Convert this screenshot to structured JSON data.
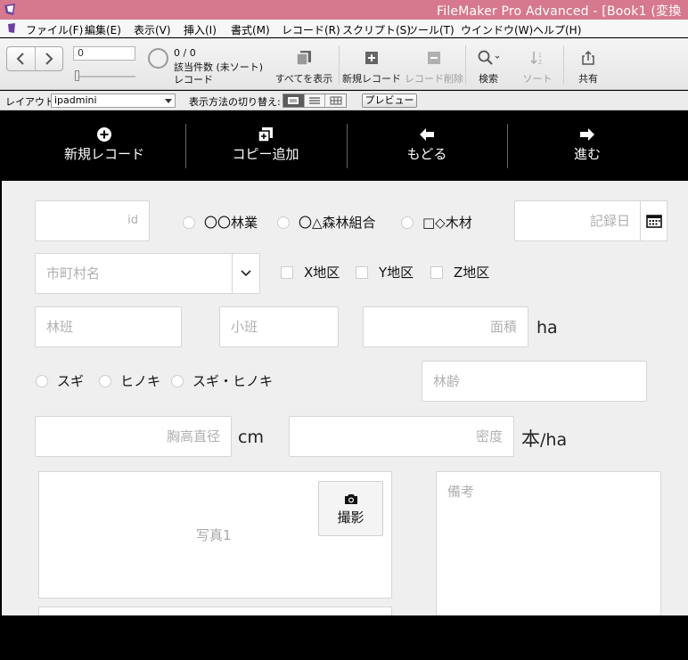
{
  "window": {
    "title": "FileMaker Pro Advanced - [Book1 (変換"
  },
  "menu": {
    "items": [
      "ファイル(F)",
      "編集(E)",
      "表示(V)",
      "挿入(I)",
      "書式(M)",
      "レコード(R)",
      "スクリプト(S)",
      "ツール(T)",
      "ウインドウ(W)",
      "ヘルプ(H)"
    ]
  },
  "toolbar": {
    "record_field_value": "0",
    "count": "0 / 0",
    "found_label": "該当件数 (未ソート)",
    "records_label": "レコード",
    "show_all_label": "すべてを表示",
    "new_record_label": "新規レコード",
    "delete_record_label": "レコード削除",
    "find_label": "検索",
    "sort_label": "ソート",
    "share_label": "共有"
  },
  "layoutbar": {
    "layout_label": "レイアウト:",
    "layout_value": "ipadmini",
    "view_as_label": "表示方法の切り替え:",
    "preview_label": "プレビュー"
  },
  "nav": {
    "new_record": "新規レコード",
    "copy_add": "コピー追加",
    "back": "もどる",
    "forward": "進む"
  },
  "form": {
    "id_placeholder": "id",
    "owners": [
      "〇〇林業",
      "〇△森林組合",
      "□◇木材"
    ],
    "record_date_placeholder": "記録日",
    "municipality_placeholder": "市町村名",
    "districts": [
      "X地区",
      "Y地区",
      "Z地区"
    ],
    "forest_compartment_placeholder": "林班",
    "sub_compartment_placeholder": "小班",
    "area_placeholder": "面積",
    "area_unit": "ha",
    "species": [
      "スギ",
      "ヒノキ",
      "スギ・ヒノキ"
    ],
    "stand_age_placeholder": "林齢",
    "dbh_placeholder": "胸高直径",
    "dbh_unit": "cm",
    "density_placeholder": "密度",
    "density_unit_kanji": "本",
    "density_unit_rest": "/ha",
    "photo1_label": "写真1",
    "shoot_label": "撮影",
    "notes_placeholder": "備考"
  },
  "colors": {
    "titlebar": "#d6788e",
    "nav_header": "#000000",
    "form_background": "#efefef"
  }
}
